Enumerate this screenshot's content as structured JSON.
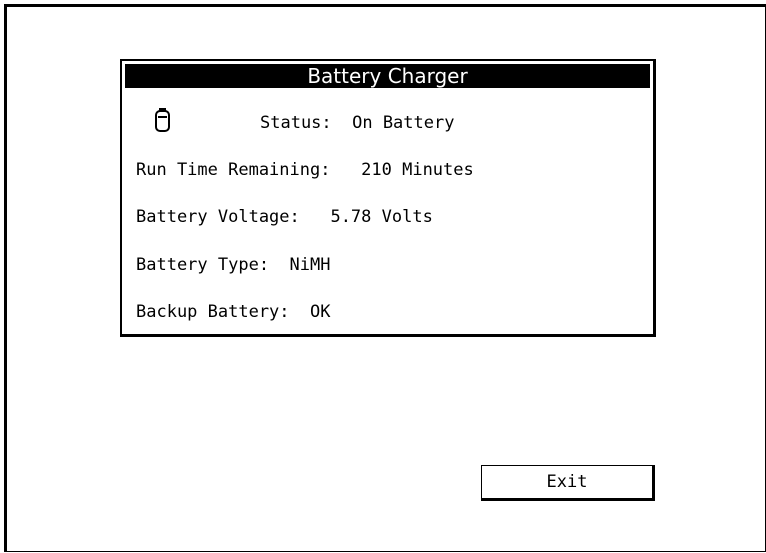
{
  "dialog": {
    "title": "Battery Charger",
    "status_icon": "battery-icon",
    "status_text": "Status:  On Battery",
    "run_time_text": "Run Time Remaining:   210 Minutes",
    "voltage_text": "Battery Voltage:   5.78 Volts",
    "type_text": "Battery Type:  NiMH",
    "backup_text": "Backup Battery:  OK"
  },
  "buttons": {
    "exit_label": "Exit"
  },
  "colors": {
    "title_bar_background": "#000000",
    "title_text": "#ffffff",
    "text": "#000000",
    "background": "#ffffff"
  }
}
